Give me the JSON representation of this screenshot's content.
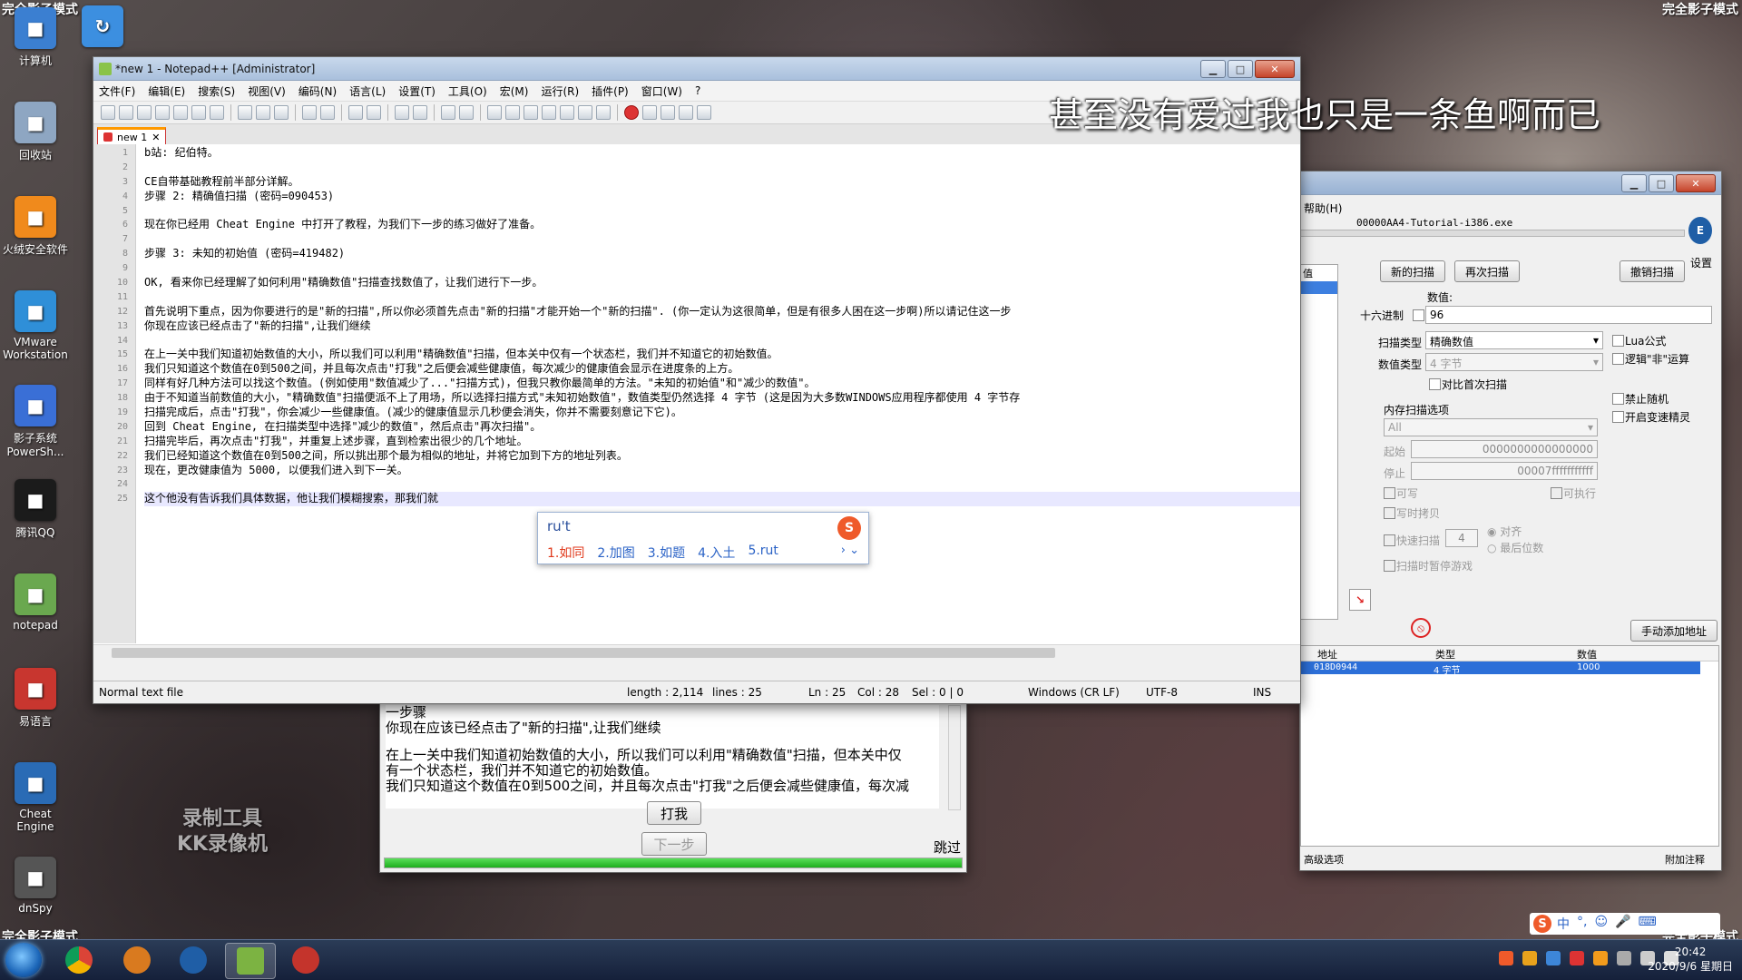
{
  "overlay": {
    "corner_left_top": "完全影子模式",
    "corner_right_top": "完全影子模式",
    "corner_left_bottom": "完全影子模式",
    "corner_right_bottom": "完全影子模式",
    "caption": "甚至没有爱过我也只是一条鱼啊而已",
    "watermark_line1": "录制工具",
    "watermark_line2": "KK录像机"
  },
  "desktop_icons": [
    {
      "label": "计算机",
      "icon": "computer-icon",
      "color": "#3b7fd1"
    },
    {
      "label": "回收站",
      "icon": "recycle-bin-icon",
      "color": "#8ea6c2"
    },
    {
      "label": "火绒安全软件",
      "icon": "huorong-icon",
      "color": "#f08a1c"
    },
    {
      "label": "VMware Workstation",
      "icon": "vmware-icon",
      "color": "#2f8fd8"
    },
    {
      "label": "影子系统 PowerSh...",
      "icon": "shadow-system-icon",
      "color": "#3a6fd6"
    },
    {
      "label": "腾讯QQ",
      "icon": "qq-icon",
      "color": "#1b1b1b"
    },
    {
      "label": "notepad",
      "icon": "notepad-icon",
      "color": "#6aa84f"
    },
    {
      "label": "易语言",
      "icon": "yiyuyan-icon",
      "color": "#c8362f"
    },
    {
      "label": "Cheat Engine",
      "icon": "cheat-engine-icon",
      "color": "#2a6bb5"
    },
    {
      "label": "dnSpy",
      "icon": "dnspy-icon",
      "color": "#555555"
    }
  ],
  "notepad": {
    "title": "*new 1 - Notepad++ [Administrator]",
    "menu": [
      "文件(F)",
      "编辑(E)",
      "搜索(S)",
      "视图(V)",
      "编码(N)",
      "语言(L)",
      "设置(T)",
      "工具(O)",
      "宏(M)",
      "运行(R)",
      "插件(P)",
      "窗口(W)",
      "?"
    ],
    "tab_label": "new 1",
    "line_numbers": [
      "1",
      "2",
      "3",
      "4",
      "5",
      "6",
      "7",
      "8",
      "9",
      "10",
      "11",
      "12",
      "13",
      "14",
      "15",
      "16",
      "17",
      "18",
      "19",
      "20",
      "21",
      "22",
      "23",
      "24",
      "25"
    ],
    "lines": [
      "b站: 纪伯特。",
      "",
      "CE自带基础教程前半部分详解。",
      "步骤 2: 精确值扫描 (密码=090453)",
      "",
      "现在你已经用 Cheat Engine 中打开了教程，为我们下一步的练习做好了准备。",
      "",
      "步骤 3: 未知的初始值 (密码=419482)",
      "",
      "OK, 看来你已经理解了如何利用\"精确数值\"扫描查找数值了，让我们进行下一步。",
      "",
      "首先说明下重点，因为你要进行的是\"新的扫描\",所以你必须首先点击\"新的扫描\"才能开始一个\"新的扫描\". (你一定认为这很简单，但是有很多人困在这一步啊)所以请记住这一步",
      "你现在应该已经点击了\"新的扫描\",让我们继续",
      "",
      "在上一关中我们知道初始数值的大小，所以我们可以利用\"精确数值\"扫描，但本关中仅有一个状态栏，我们并不知道它的初始数值。",
      "我们只知道这个数值在0到500之间，并且每次点击\"打我\"之后便会减些健康值，每次减少的健康值会显示在进度条的上方。",
      "同样有好几种方法可以找这个数值。(例如使用\"数值减少了...\"扫描方式)，但我只教你最简单的方法。\"未知的初始值\"和\"减少的数值\"。",
      "由于不知道当前数值的大小，\"精确数值\"扫描便派不上了用场，所以选择扫描方式\"未知初始数值\"，数值类型仍然选择 4 字节 (这是因为大多数WINDOWS应用程序都使用 4 字节存",
      "扫描完成后，点击\"打我\"，你会减少一些健康值。(减少的健康值显示几秒便会消失，你并不需要刻意记下它)。",
      "回到 Cheat Engine, 在扫描类型中选择\"减少的数值\"，然后点击\"再次扫描\"。",
      "扫描完毕后，再次点击\"打我\"，并重复上述步骤，直到检索出很少的几个地址。",
      "我们已经知道这个数值在0到500之间，所以挑出那个最为相似的地址，并将它加到下方的地址列表。",
      "现在，更改健康值为 5000, 以便我们进入到下一关。",
      "",
      "这个他没有告诉我们具体数据，他让我们模糊搜索，那我们就"
    ],
    "status": {
      "filetype": "Normal text file",
      "length": "length : 2,114",
      "lines": "lines : 25",
      "ln": "Ln : 25",
      "col": "Col : 28",
      "sel": "Sel : 0 | 0",
      "eol": "Windows (CR LF)",
      "encoding": "UTF-8",
      "mode": "INS"
    }
  },
  "ime": {
    "composition": "ru't",
    "candidates": [
      "1.如同",
      "2.加图",
      "3.如题",
      "4.入土",
      "5.rut"
    ],
    "bar": [
      "中",
      "°,",
      "☺",
      "🎤",
      "⌨"
    ]
  },
  "cheat_engine": {
    "menu_help": "帮助(H)",
    "process": "00000AA4-Tutorial-i386.exe",
    "settings_label": "设置",
    "left_header": "值",
    "new_scan": "新的扫描",
    "next_scan": "再次扫描",
    "undo_scan": "撤销扫描",
    "value_label": "数值:",
    "hex_label": "十六进制",
    "value": "96",
    "scan_type_label": "扫描类型",
    "scan_type": "精确数值",
    "value_type_label": "数值类型",
    "value_type": "4 字节",
    "compare_first": "对比首次扫描",
    "lua": "Lua公式",
    "logic_not": "逻辑\"非\"运算",
    "no_random": "禁止随机",
    "speedhack": "开启变速精灵",
    "mem_options": "内存扫描选项",
    "mem_region": "All",
    "start_label": "起始",
    "start": "0000000000000000",
    "stop_label": "停止",
    "stop": "00007fffffffffff",
    "writable": "可写",
    "executable": "可执行",
    "copy_on_write": "写时拷贝",
    "fast_scan": "快速扫描",
    "fast_value": "4",
    "align": "对齐",
    "last_digits": "最后位数",
    "pause_game": "扫描时暂停游戏",
    "manual_add": "手动添加地址",
    "col_address": "地址",
    "col_type": "类型",
    "col_value": "数值",
    "row": {
      "address": "018D0944",
      "type": "4 字节",
      "value": "1000"
    },
    "advanced": "高级选项",
    "comments": "附加注释"
  },
  "tutorial": {
    "text": [
      "一步骤",
      "你现在应该已经点击了\"新的扫描\",让我们继续",
      "",
      "在上一关中我们知道初始数值的大小，所以我们可以利用\"精确数值\"扫描，但本关中仅",
      "有一个状态栏，我们并不知道它的初始数值。",
      "我们只知道这个数值在0到500之间，并且每次点击\"打我\"之后便会减些健康值，每次减"
    ],
    "hit_button": "打我",
    "next_button": "下一步",
    "skip": "跳过",
    "health_fraction": 1.0
  },
  "taskbar": {
    "time": "20:42",
    "date": "2020/9/6 星期日"
  }
}
